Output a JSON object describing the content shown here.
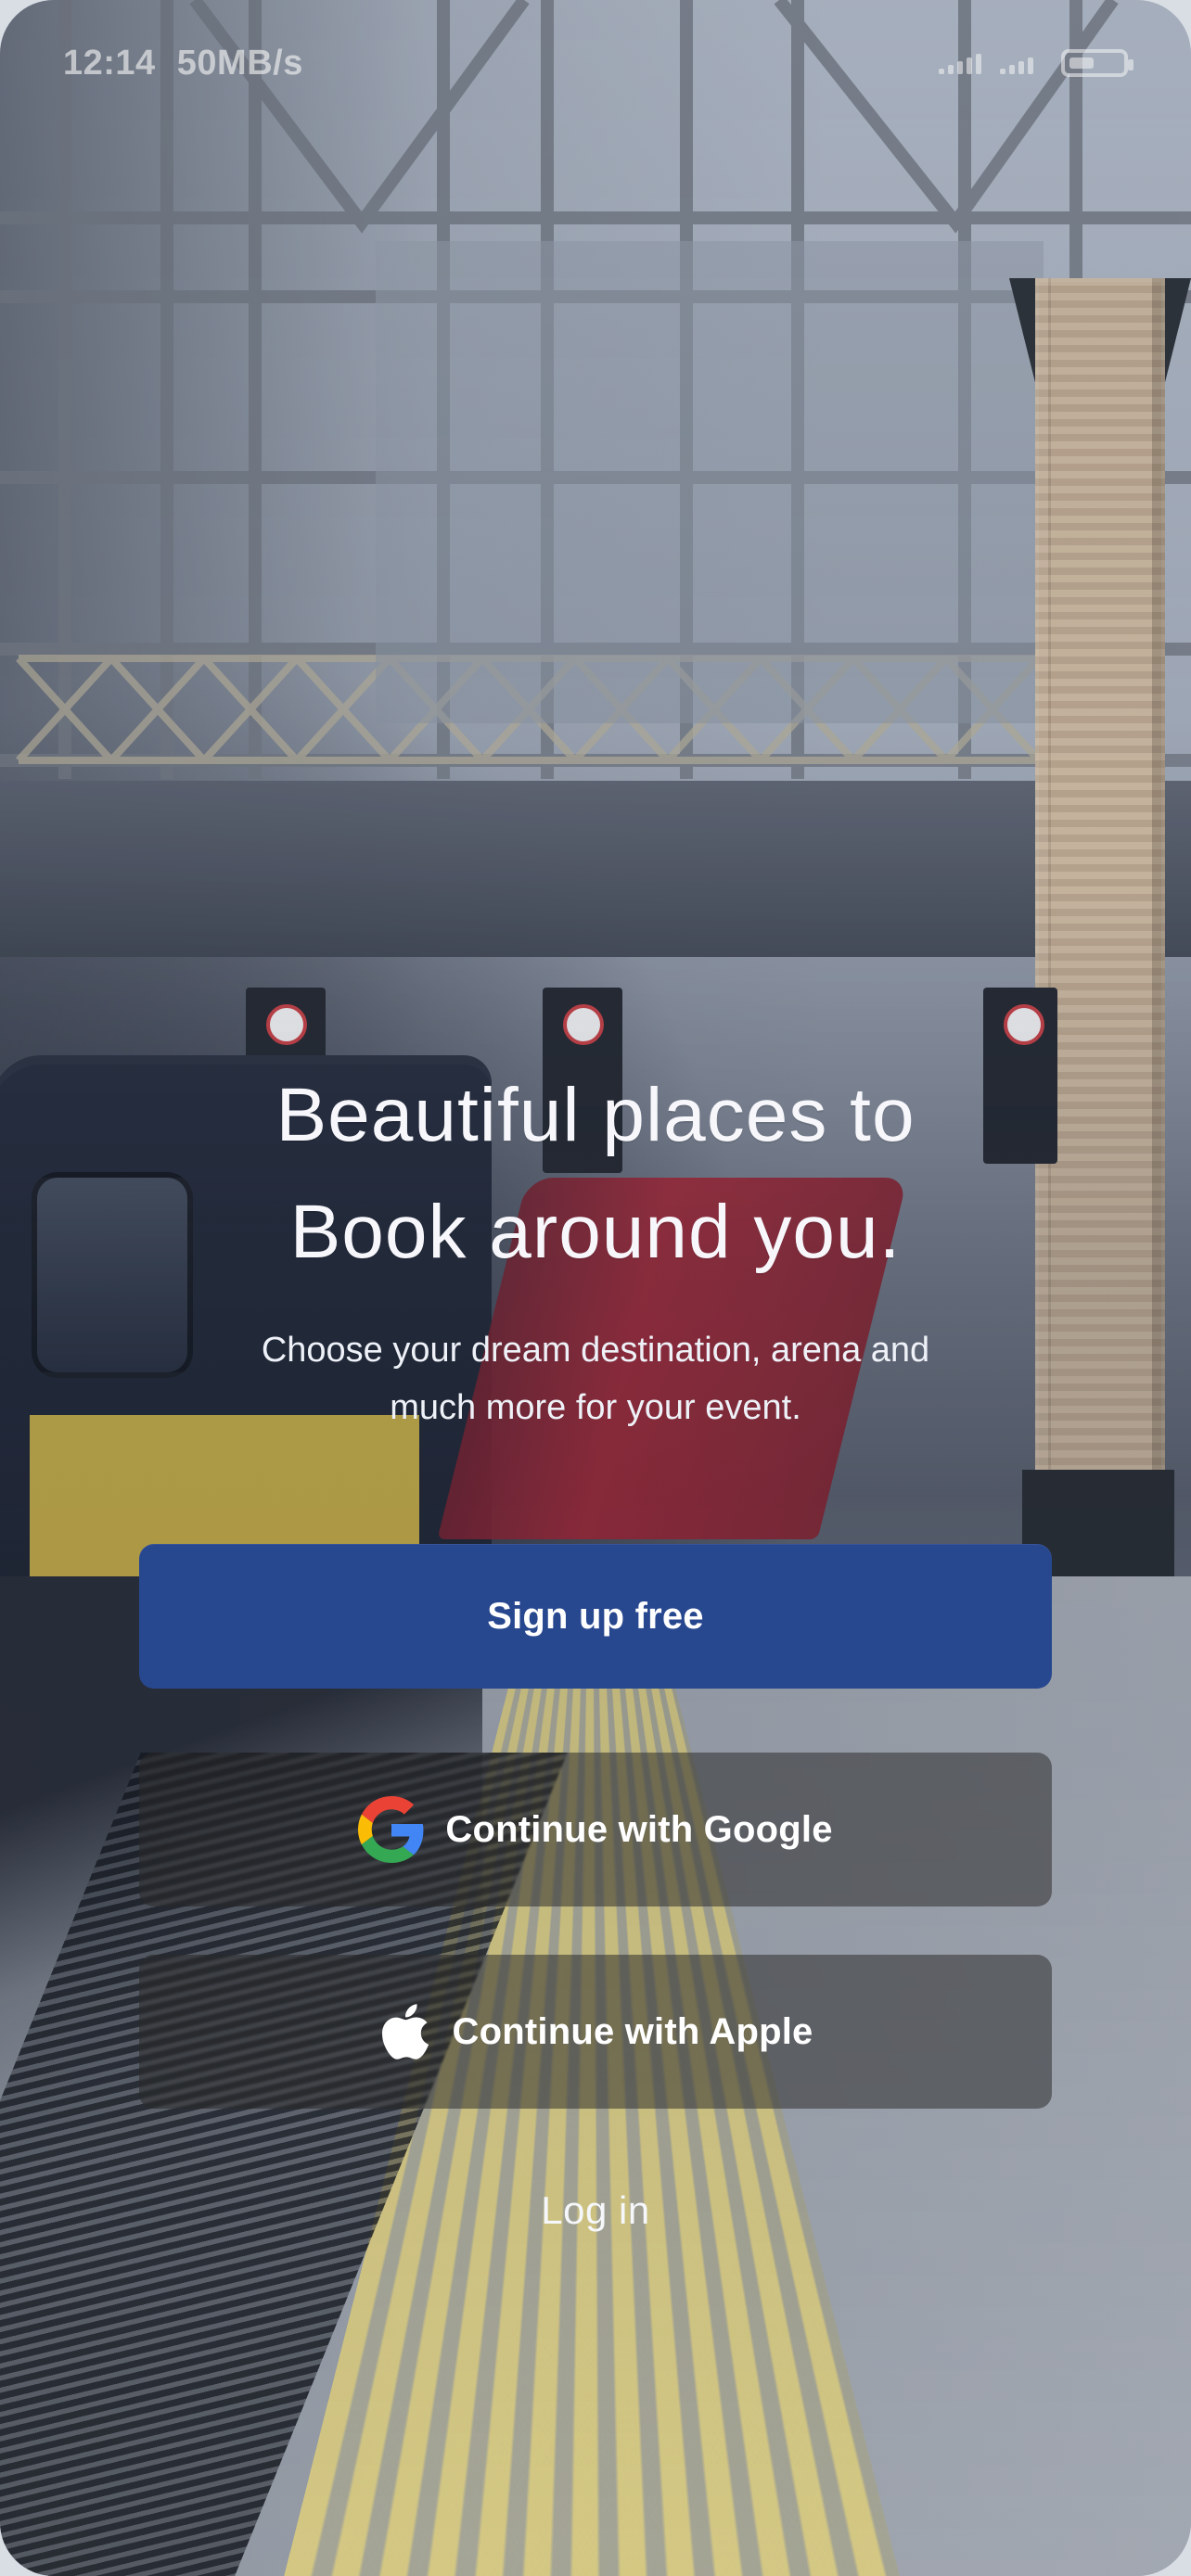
{
  "status_bar": {
    "time": "12:14",
    "speed": "50MB/s"
  },
  "hero": {
    "title_line_1": "Beautiful places to",
    "title_line_2": "Book around you.",
    "subtitle_line_1": "Choose your dream destination, arena and",
    "subtitle_line_2": "much more for your event."
  },
  "actions": {
    "signup_label": "Sign up free",
    "google_label": "Continue with Google",
    "apple_label": "Continue with Apple",
    "login_label": "Log in"
  },
  "icons": {
    "google": "google-icon",
    "apple": "apple-icon"
  },
  "colors": {
    "primary_button": "#27478f",
    "dark_button": "#3a3a3a",
    "text": "#ffffff"
  }
}
